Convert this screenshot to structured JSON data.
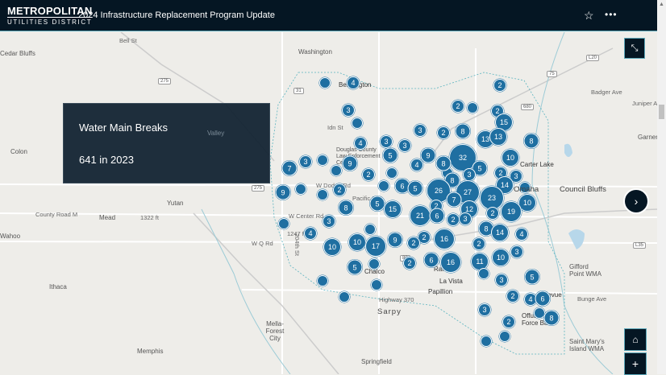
{
  "header": {
    "logo_line1": "METROPOLITAN",
    "logo_line2": "UTILITIES DISTRICT",
    "title": "2024 Infrastructure Replacement Program Update",
    "favorite_icon": "star-icon",
    "more_icon": "ellipsis-icon"
  },
  "panel": {
    "heading": "Water Main Breaks",
    "value": "641 in 2023"
  },
  "colors": {
    "header": "#051623",
    "marker": "#1f6fa1",
    "panel": "#112231"
  },
  "map_labels": {
    "cedar_bluffs": "Cedar Bluffs",
    "washington": "Washington",
    "bennington": "Bennington",
    "colon": "Colon",
    "valley": "Valley",
    "yutan": "Yutan",
    "mead": "Mead",
    "county_road_m": "County Road M",
    "wahoo": "Wahoo",
    "ithaca": "Ithaca",
    "memphis": "Memphis",
    "mella": "Mella-Forest City",
    "sarpy": "Sarpy",
    "springfield": "Springfield",
    "papillion": "Papillion",
    "highway_370": "Highway 370",
    "chalco": "Chalco",
    "carter_lake": "Carter Lake",
    "council_bluffs": "Council Bluffs",
    "garner": "Garner",
    "gifford": "Gifford Point WMA",
    "bunge": "Bunge Ave",
    "offutt": "Offutt Air Force Base",
    "st_marys": "Saint Mary's Island WMA",
    "omaha": "Omaha",
    "bellevue": "Bellevue",
    "w_dodge": "W Dodge Rd",
    "pacific": "Pacific St",
    "w_center": "W Center Rd",
    "w_q": "W Q Rd",
    "douglas": "Douglas County Law Enforcement Center",
    "idn_st": "Idn St",
    "ralston": "Ralston",
    "la_vista": "La Vista",
    "elev1": "1322 ft",
    "elev2": "1247 ft",
    "badger": "Badger Ave",
    "juniper": "Juniper Ave",
    "st204": "204th St",
    "bell_st": "Bell St"
  },
  "shields": [
    "275",
    "31",
    "680",
    "L20",
    "80",
    "L35",
    "275",
    "75"
  ],
  "marker_counts": [
    "",
    "4",
    "3",
    "",
    "2",
    "2",
    "",
    "2",
    "15",
    "3",
    "2",
    "8",
    "13",
    "13",
    "8",
    "4",
    "3",
    "3",
    "9",
    "32",
    "5",
    "10",
    "7",
    "3",
    "",
    "9",
    "4",
    "",
    "8",
    "5",
    "",
    "2",
    "",
    "3",
    "8",
    "2",
    "3",
    "14",
    "9",
    "",
    "2",
    "",
    "",
    "6",
    "5",
    "26",
    "27",
    "23",
    "",
    "10",
    "7",
    "2",
    "8",
    "5",
    "15",
    "19",
    "12",
    "2",
    "21",
    "6",
    "2",
    "3",
    "",
    "3",
    "",
    "4",
    "8",
    "14",
    "4",
    "10",
    "10",
    "17",
    "9",
    "2",
    "2",
    "16",
    "2",
    "3",
    "5",
    "",
    "2",
    "6",
    "16",
    "11",
    "10",
    "",
    "3",
    "",
    "",
    "",
    "5",
    "2",
    "4",
    "6",
    "",
    "8",
    "3",
    "2",
    "",
    ""
  ],
  "controls": {
    "expand_icon": "expand-icon",
    "next_icon": "chevron-right-icon",
    "home_icon": "home-icon",
    "zoom_in_icon": "plus-icon"
  }
}
